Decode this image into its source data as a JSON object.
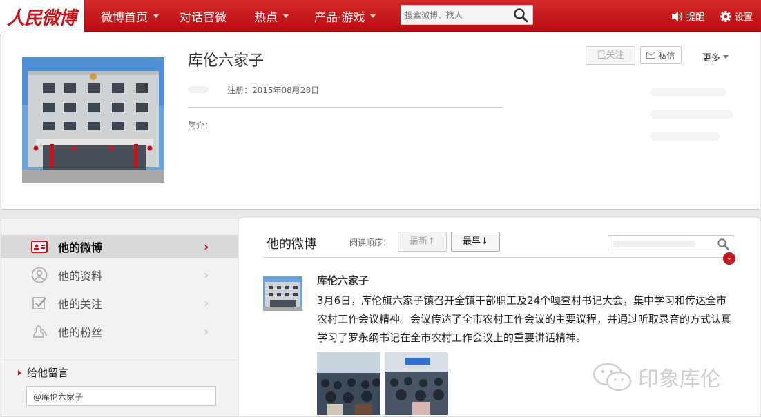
{
  "topbar": {
    "logo": "人民微博",
    "nav": [
      {
        "label": "微博首页",
        "has_menu": true
      },
      {
        "label": "对话官微",
        "has_menu": false
      },
      {
        "label": "热点",
        "has_menu": true
      },
      {
        "label": "产品·游戏",
        "has_menu": true
      }
    ],
    "search_placeholder": "搜索微博、找人",
    "remind_label": "提醒",
    "settings_label": "设置"
  },
  "profile": {
    "name": "库伦六家子",
    "registered": "注册：2015年08月28日",
    "bio_label": "简介：",
    "followed_button": "已关注",
    "message_button": "私信",
    "more_label": "更多"
  },
  "sidebar": {
    "items": [
      {
        "label": "他的微博",
        "icon": "id-card-icon",
        "active": true
      },
      {
        "label": "他的资料",
        "icon": "person-icon",
        "active": false
      },
      {
        "label": "他的关注",
        "icon": "checkbox-icon",
        "active": false
      },
      {
        "label": "他的粉丝",
        "icon": "fans-icon",
        "active": false
      }
    ],
    "message_title": "给他留言",
    "message_input_value": "@库伦六家子"
  },
  "feed": {
    "title": "他的微博",
    "order_label": "阅读顺序：",
    "newest_button": "最新↑",
    "oldest_button": "最早↓",
    "post": {
      "author": "库伦六家子",
      "text": "3月6日，库伦旗六家子镇召开全镇干部职工及24个嘎查村书记大会，集中学习和传达全市农村工作会议精神。会议传达了全市农村工作会议的主要议程，并通过听取录音的方式认真学习了罗永纲书记在全市农村工作会议上的重要讲话精神。"
    }
  },
  "watermark": "印象库伦",
  "colors": {
    "brand_red": "#c4161c",
    "topbar_red": "#c61a1d"
  }
}
